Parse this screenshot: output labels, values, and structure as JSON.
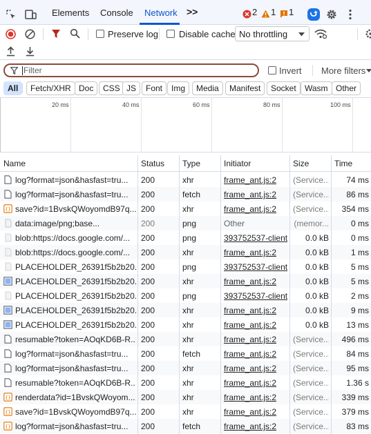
{
  "tabs": {
    "elements": "Elements",
    "console": "Console",
    "network": "Network",
    "more": ">>"
  },
  "badges": {
    "errors": "2",
    "warnings": "1",
    "issues": "1"
  },
  "toolbar": {
    "preserve_log": "Preserve log",
    "disable_cache": "Disable cache",
    "throttling": "No throttling"
  },
  "filter": {
    "placeholder": "Filter",
    "invert": "Invert",
    "more_filters": "More filters"
  },
  "chips": [
    "All",
    "Fetch/XHR",
    "Doc",
    "CSS",
    "JS",
    "Font",
    "Img",
    "Media",
    "Manifest",
    "Socket",
    "Wasm",
    "Other"
  ],
  "overview_ticks": [
    "20 ms",
    "40 ms",
    "60 ms",
    "80 ms",
    "100 ms"
  ],
  "columns": {
    "name": "Name",
    "status": "Status",
    "type": "Type",
    "initiator": "Initiator",
    "size": "Size",
    "time": "Time"
  },
  "rows": [
    {
      "icon": "doc-icon",
      "name": "log?format=json&hasfast=tru...",
      "status": "200",
      "type": "xhr",
      "initiator": "frame_ant.js:2",
      "size": "(Service...",
      "time": "74 ms"
    },
    {
      "icon": "doc-icon",
      "name": "log?format=json&hasfast=tru...",
      "status": "200",
      "type": "fetch",
      "initiator": "frame_ant.js:2",
      "size": "(Service...",
      "time": "86 ms"
    },
    {
      "icon": "script-icon",
      "name": "save?id=1BvskQWoyomdB97q...",
      "status": "200",
      "type": "xhr",
      "initiator": "frame_ant.js:2",
      "size": "(Service...",
      "time": "354 ms"
    },
    {
      "icon": "data-icon",
      "name": "data:image/png;base...",
      "status": "200",
      "type": "png",
      "initiator": "Other",
      "size": "(memor...",
      "time": "0 ms"
    },
    {
      "icon": "blank-icon",
      "name": "blob:https://docs.google.com/...",
      "status": "200",
      "type": "png",
      "initiator": "393752537-client",
      "size": "0.0 kB",
      "time": "0 ms"
    },
    {
      "icon": "blank-icon",
      "name": "blob:https://docs.google.com/...",
      "status": "200",
      "type": "xhr",
      "initiator": "frame_ant.js:2",
      "size": "0.0 kB",
      "time": "1 ms"
    },
    {
      "icon": "blank-icon",
      "name": "PLACEHOLDER_26391f5b2b20...",
      "status": "200",
      "type": "png",
      "initiator": "393752537-client",
      "size": "0.0 kB",
      "time": "5 ms"
    },
    {
      "icon": "image-icon",
      "name": "PLACEHOLDER_26391f5b2b20...",
      "status": "200",
      "type": "xhr",
      "initiator": "frame_ant.js:2",
      "size": "0.0 kB",
      "time": "5 ms"
    },
    {
      "icon": "blank-icon",
      "name": "PLACEHOLDER_26391f5b2b20...",
      "status": "200",
      "type": "png",
      "initiator": "393752537-client",
      "size": "0.0 kB",
      "time": "2 ms"
    },
    {
      "icon": "image-icon",
      "name": "PLACEHOLDER_26391f5b2b20...",
      "status": "200",
      "type": "xhr",
      "initiator": "frame_ant.js:2",
      "size": "0.0 kB",
      "time": "9 ms"
    },
    {
      "icon": "image-icon",
      "name": "PLACEHOLDER_26391f5b2b20...",
      "status": "200",
      "type": "xhr",
      "initiator": "frame_ant.js:2",
      "size": "0.0 kB",
      "time": "13 ms"
    },
    {
      "icon": "doc-icon",
      "name": "resumable?token=AOqKD6B-R...",
      "status": "200",
      "type": "xhr",
      "initiator": "frame_ant.js:2",
      "size": "(Service...",
      "time": "496 ms"
    },
    {
      "icon": "doc-icon",
      "name": "log?format=json&hasfast=tru...",
      "status": "200",
      "type": "fetch",
      "initiator": "frame_ant.js:2",
      "size": "(Service...",
      "time": "84 ms"
    },
    {
      "icon": "doc-icon",
      "name": "log?format=json&hasfast=tru...",
      "status": "200",
      "type": "xhr",
      "initiator": "frame_ant.js:2",
      "size": "(Service...",
      "time": "95 ms"
    },
    {
      "icon": "doc-icon",
      "name": "resumable?token=AOqKD6B-R...",
      "status": "200",
      "type": "xhr",
      "initiator": "frame_ant.js:2",
      "size": "(Service...",
      "time": "1.36 s"
    },
    {
      "icon": "script-icon",
      "name": "renderdata?id=1BvskQWoyom...",
      "status": "200",
      "type": "xhr",
      "initiator": "frame_ant.js:2",
      "size": "(Service...",
      "time": "339 ms"
    },
    {
      "icon": "script-icon",
      "name": "save?id=1BvskQWoyomdB97q...",
      "status": "200",
      "type": "xhr",
      "initiator": "frame_ant.js:2",
      "size": "(Service...",
      "time": "379 ms"
    },
    {
      "icon": "script-icon",
      "name": "log?format=json&hasfast=tru...",
      "status": "200",
      "type": "fetch",
      "initiator": "frame_ant.js:2",
      "size": "(Service...",
      "time": "83 ms"
    }
  ]
}
